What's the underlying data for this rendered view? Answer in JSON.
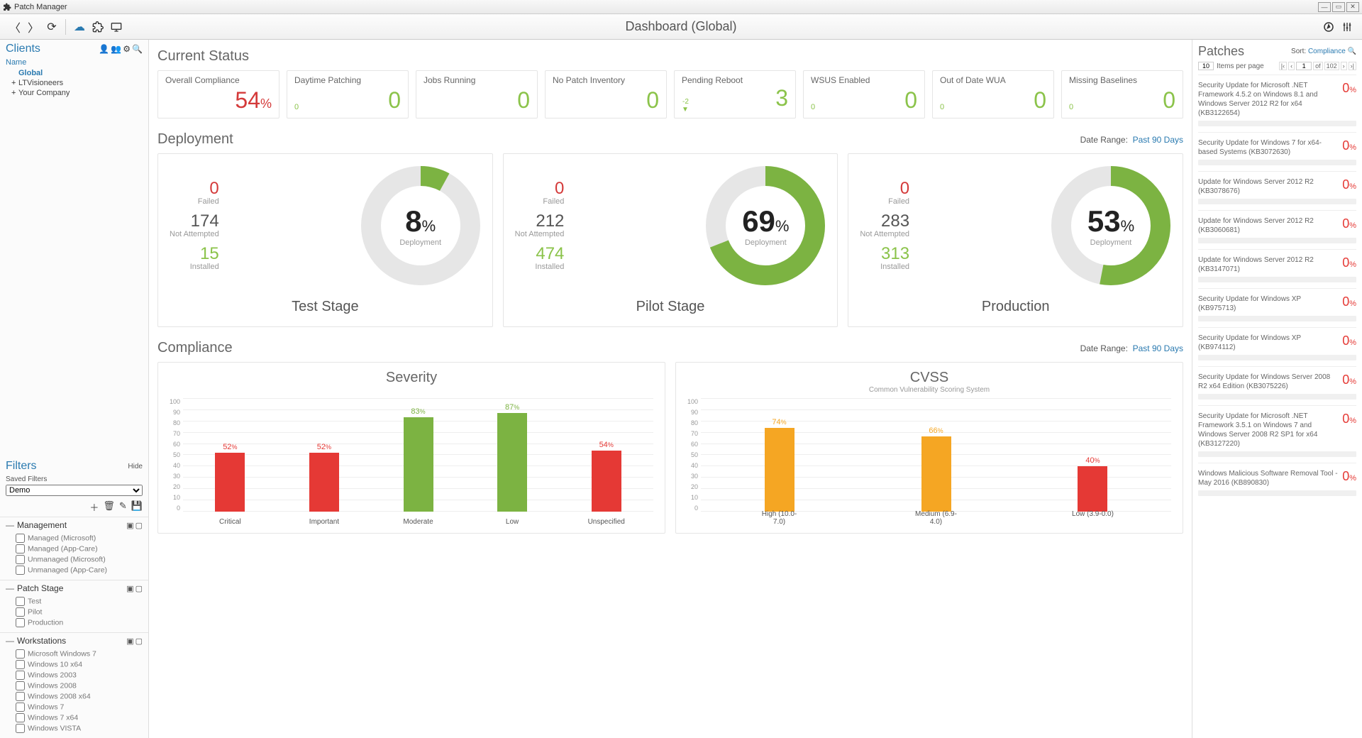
{
  "app": {
    "title": "Patch Manager"
  },
  "toolbar": {
    "page_title": "Dashboard (Global)"
  },
  "clients": {
    "heading": "Clients",
    "name_label": "Name",
    "tree": {
      "global": "Global",
      "items": [
        "LTVisioneers",
        "Your Company"
      ]
    }
  },
  "filters": {
    "heading": "Filters",
    "hide": "Hide",
    "saved_label": "Saved Filters",
    "saved_value": "Demo",
    "groups": [
      {
        "name": "Management",
        "opts": [
          "Managed (Microsoft)",
          "Managed (App-Care)",
          "Unmanaged (Microsoft)",
          "Unmanaged (App-Care)"
        ]
      },
      {
        "name": "Patch Stage",
        "opts": [
          "Test",
          "Pilot",
          "Production"
        ]
      },
      {
        "name": "Workstations",
        "opts": [
          "Microsoft Windows 7",
          "Windows 10 x64",
          "Windows 2003",
          "Windows 2008",
          "Windows 2008 x64",
          "Windows 7",
          "Windows 7 x64",
          "Windows VISTA"
        ]
      }
    ]
  },
  "status": {
    "title": "Current Status",
    "cards": [
      {
        "hdr": "Overall Compliance",
        "val": "54",
        "pct": true,
        "cls": "red"
      },
      {
        "hdr": "Daytime Patching",
        "val": "0",
        "cls": "green",
        "sub": "0"
      },
      {
        "hdr": "Jobs Running",
        "val": "0",
        "cls": "green"
      },
      {
        "hdr": "No Patch Inventory",
        "val": "0",
        "cls": "green"
      },
      {
        "hdr": "Pending Reboot",
        "val": "3",
        "cls": "green",
        "trend": "-2"
      },
      {
        "hdr": "WSUS Enabled",
        "val": "0",
        "cls": "green",
        "sub": "0"
      },
      {
        "hdr": "Out of Date WUA",
        "val": "0",
        "cls": "green",
        "sub": "0"
      },
      {
        "hdr": "Missing Baselines",
        "val": "0",
        "cls": "green",
        "sub": "0"
      }
    ]
  },
  "deployment": {
    "title": "Deployment",
    "range_label": "Date Range:",
    "range_value": "Past 90 Days",
    "cards": [
      {
        "stage": "Test Stage",
        "pct": 8,
        "failed": 0,
        "na": 174,
        "inst": 15
      },
      {
        "stage": "Pilot Stage",
        "pct": 69,
        "failed": 0,
        "na": 212,
        "inst": 474
      },
      {
        "stage": "Production",
        "pct": 53,
        "failed": 0,
        "na": 283,
        "inst": 313
      }
    ],
    "labels": {
      "failed": "Failed",
      "na": "Not Attempted",
      "inst": "Installed",
      "dep": "Deployment"
    }
  },
  "compliance": {
    "title": "Compliance",
    "range_label": "Date Range:",
    "range_value": "Past 90 Days"
  },
  "chart_data": [
    {
      "type": "bar",
      "title": "Severity",
      "ylim": [
        0,
        100
      ],
      "yticks": [
        0,
        10,
        20,
        30,
        40,
        50,
        60,
        70,
        80,
        90,
        100
      ],
      "categories": [
        "Critical",
        "Important",
        "Moderate",
        "Low",
        "Unspecified"
      ],
      "values": [
        52,
        52,
        83,
        87,
        54
      ],
      "colors": [
        "r",
        "r",
        "g",
        "g",
        "r"
      ]
    },
    {
      "type": "bar",
      "title": "CVSS",
      "subtitle": "Common Vulnerability Scoring System",
      "ylim": [
        0,
        100
      ],
      "yticks": [
        0,
        10,
        20,
        30,
        40,
        50,
        60,
        70,
        80,
        90,
        100
      ],
      "categories": [
        "High (10.0-7.0)",
        "Medium (6.9-4.0)",
        "Low (3.9-0.0)"
      ],
      "values": [
        74,
        66,
        40
      ],
      "colors": [
        "o",
        "o",
        "r"
      ]
    }
  ],
  "patches": {
    "title": "Patches",
    "sort_label": "Sort:",
    "sort_value": "Compliance",
    "per_page": "10",
    "per_page_label": "Items per page",
    "page": "1",
    "total_pages": "102",
    "of": "of",
    "items": [
      {
        "desc": "Security Update for Microsoft .NET Framework 4.5.2 on Windows 8.1 and Windows Server 2012 R2 for x64 (KB3122654)",
        "pct": 0
      },
      {
        "desc": "Security Update for Windows 7 for x64-based Systems (KB3072630)",
        "pct": 0
      },
      {
        "desc": "Update for Windows Server 2012 R2 (KB3078676)",
        "pct": 0
      },
      {
        "desc": "Update for Windows Server 2012 R2 (KB3060681)",
        "pct": 0
      },
      {
        "desc": "Update for Windows Server 2012 R2 (KB3147071)",
        "pct": 0
      },
      {
        "desc": "Security Update for Windows XP (KB975713)",
        "pct": 0
      },
      {
        "desc": "Security Update for Windows XP (KB974112)",
        "pct": 0
      },
      {
        "desc": "Security Update for Windows Server 2008 R2 x64 Edition (KB3075226)",
        "pct": 0
      },
      {
        "desc": "Security Update for Microsoft .NET Framework 3.5.1 on Windows 7 and Windows Server 2008 R2 SP1 for x64 (KB3127220)",
        "pct": 0
      },
      {
        "desc": "Windows Malicious Software Removal Tool - May 2016 (KB890830)",
        "pct": 0
      }
    ]
  }
}
